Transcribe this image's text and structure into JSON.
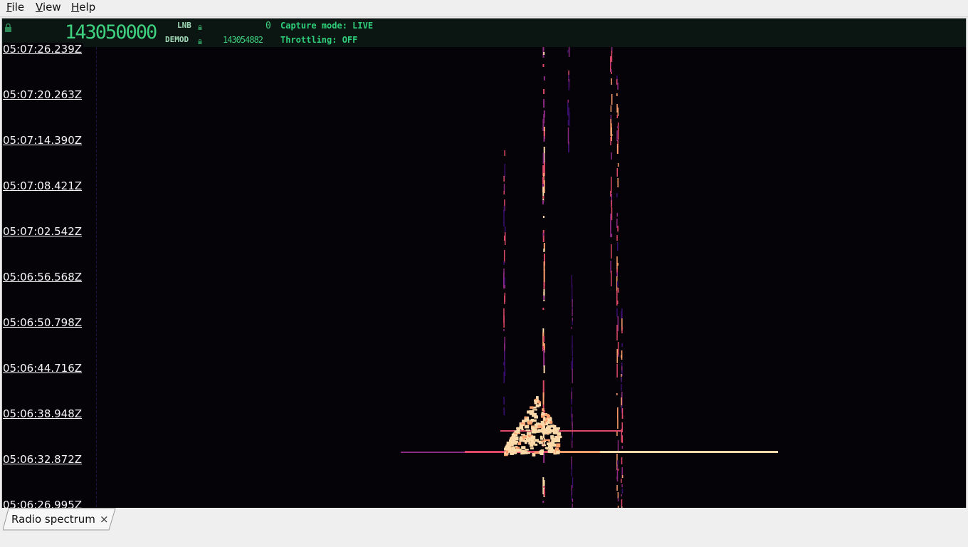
{
  "menubar": {
    "items": [
      {
        "label": "File"
      },
      {
        "label": "View"
      },
      {
        "label": "Help"
      }
    ]
  },
  "header": {
    "frequency": "143050000",
    "lnb_label": "LNB",
    "lnb_value": "0",
    "demod_label": "DEMOD",
    "demod_value": "143054882",
    "capture_mode": "Capture mode: LIVE",
    "throttling": "Throttling: OFF",
    "lcd_color": "#3ed17f"
  },
  "waterfall": {
    "timestamps": [
      "05:07:26.239Z",
      "05:07:20.263Z",
      "05:07:14.390Z",
      "05:07:08.421Z",
      "05:07:02.542Z",
      "05:06:56.568Z",
      "05:06:50.798Z",
      "05:06:44.716Z",
      "05:06:38.948Z",
      "05:06:32.872Z",
      "05:06:26.995Z"
    ],
    "colormap": [
      "#050308",
      "#3b0f70",
      "#8c2981",
      "#de4968",
      "#fe9f6d",
      "#fcd9a8"
    ]
  },
  "tabs": [
    {
      "label": "Radio spectrum",
      "close": "×"
    }
  ]
}
